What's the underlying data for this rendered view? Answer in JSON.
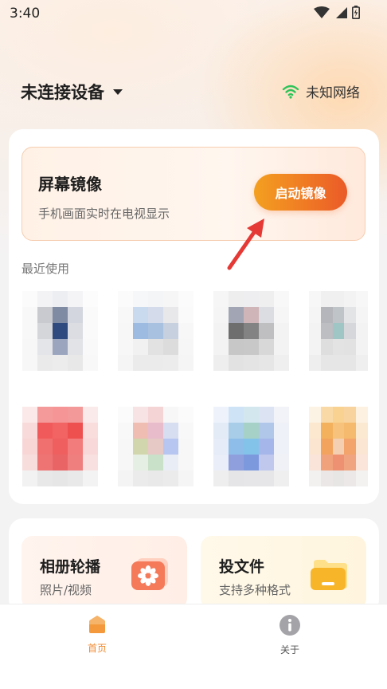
{
  "status_bar": {
    "time": "3:40"
  },
  "header": {
    "device_title": "未连接设备",
    "network_label": "未知网络",
    "network_icon": "wifi-icon"
  },
  "mirror": {
    "title": "屏幕镜像",
    "subtitle": "手机画面实时在电视显示",
    "button_label": "启动镜像"
  },
  "recent": {
    "label": "最近使用"
  },
  "features": [
    {
      "title": "相册轮播",
      "subtitle": "照片/视频",
      "icon": "photo-flower-icon"
    },
    {
      "title": "投文件",
      "subtitle": "支持多种格式",
      "icon": "folder-icon"
    }
  ],
  "nav": {
    "home_label": "首页",
    "about_label": "关于"
  },
  "colors": {
    "accent": "#f07a24",
    "button_start": "#f3a020",
    "button_end": "#ea5a28",
    "nav_active": "#f08a30",
    "wifi": "#2fc35a",
    "arrow": "#e53935"
  }
}
